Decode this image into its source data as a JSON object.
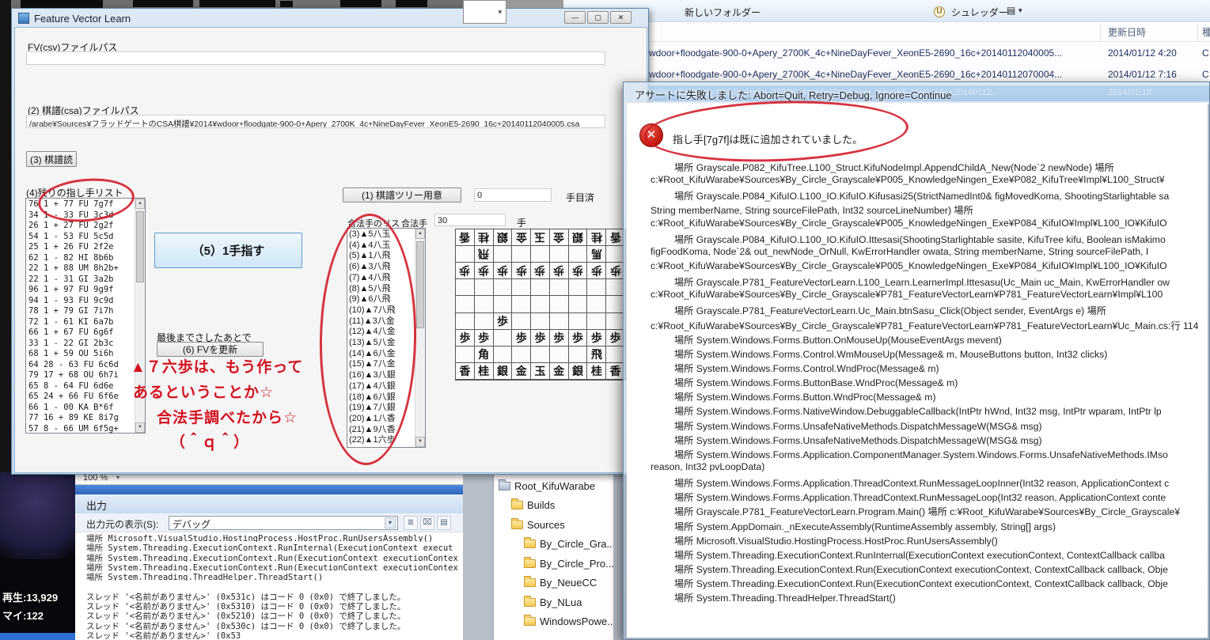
{
  "icons": {
    "minimize": "—",
    "maximize": "▢",
    "close": "✕",
    "caret_down": "▾",
    "arrow_up": "▲",
    "arrow_down": "▼",
    "error_cross": "✕",
    "circled_u": "U",
    "list_view": "▤",
    "large_view": "▦",
    "clear": "⌧",
    "wrap": "≣"
  },
  "fv_window": {
    "title": "Feature Vector Learn",
    "fv_path_label": "FV(csv)ファイルパス",
    "fv_path_value": "",
    "csa_path_label": "(2) 棋譜(csa)ファイルパス",
    "csa_path_value": "/arabe¥Sources¥フラッドゲートのCSA棋譜¥2014¥wdoor+floodgate-900-0+Apery_2700K_4c+NineDayFever_XeonE5-2690_16c+20140112040005.csa",
    "read_button": "(3) 棋譜読",
    "remaining_label": "(4)残りの指し手リスト",
    "moves": [
      "76 1 + 77 FU 7g7f",
      "34 1 - 33 FU 3c3d",
      "26 1 + 27 FU 2g2f",
      "54 1 - 53 FU 5c5d",
      "25 1 + 26 FU 2f2e",
      "62 1 - 82 HI 8b6b",
      "22 1 + 88 UM 8h2b+",
      "22 1 - 31 GI 3a2b",
      "96 1 + 97 FU 9g9f",
      "94 1 - 93 FU 9c9d",
      "78 1 + 79 GI 7i7h",
      "72 1 - 61 KI 6a7b",
      "66 1 + 67 FU 6g6f",
      "33 1 - 22 GI 2b3c",
      "68 1 + 59 OU 5i6h",
      "64 28 - 63 FU 6c6d",
      "79 17 + 68 OU 6h7i",
      "65 8 - 64 FU 6d6e",
      "65 24 + 66 FU 6f6e",
      "66 1 - 00 KA B*6f",
      "77 16 + 89 KE 8i7g",
      "57 8 - 66 UM 6f5g+"
    ],
    "play_button": "（5）1手指す",
    "after_label": "最後までさしたあとで",
    "fv_update_button": "(6) FVを更新",
    "tree_button": "(1) 棋譜ツリー用意",
    "steps_done_value": "0",
    "steps_done_label": "手目済",
    "legal_list_label": "合法手のリス",
    "legal_label": "合法手",
    "legal_count": "30",
    "legal_unit": "手",
    "legal_moves": [
      "(3)▲5八玉",
      "(4)▲4八玉",
      "(5)▲1八飛",
      "(6)▲3八飛",
      "(7)▲4八飛",
      "(8)▲5八飛",
      "(9)▲6八飛",
      "(10)▲7八飛",
      "(11)▲3八金",
      "(12)▲4八金",
      "(13)▲5八金",
      "(14)▲6八金",
      "(15)▲7八金",
      "(16)▲3八銀",
      "(17)▲4八銀",
      "(18)▲6八銀",
      "(19)▲7八銀",
      "(20)▲1八香",
      "(21)▲9八香",
      "(22)▲1六歩"
    ],
    "annotations": [
      "▲７六歩は、もう作って",
      "あるということか☆",
      "合法手調べたから☆",
      "（＾ｑ＾）"
    ],
    "board": [
      [
        "v香",
        "v桂",
        "v銀",
        "v金",
        "v玉",
        "v金",
        "v銀",
        "v桂",
        "v香"
      ],
      [
        "",
        "v飛",
        "",
        "",
        "",
        "",
        "",
        "v馬",
        ""
      ],
      [
        "v歩",
        "v歩",
        "v歩",
        "v歩",
        "v歩",
        "v歩",
        "v歩",
        "v歩",
        "v歩"
      ],
      [
        "",
        "",
        "",
        "",
        "",
        "",
        "",
        "",
        ""
      ],
      [
        "",
        "",
        "",
        "",
        "",
        "",
        "",
        "",
        ""
      ],
      [
        "",
        "",
        "歩",
        "",
        "",
        "",
        "",
        "",
        ""
      ],
      [
        "歩",
        "歩",
        "",
        "歩",
        "歩",
        "歩",
        "歩",
        "歩",
        "歩"
      ],
      [
        "",
        "角",
        "",
        "",
        "",
        "",
        "",
        "飛",
        ""
      ],
      [
        "香",
        "桂",
        "銀",
        "金",
        "玉",
        "金",
        "銀",
        "桂",
        "香"
      ]
    ]
  },
  "explorer": {
    "new_folder": "新しいフォルダー",
    "shredder": "シュレッダー",
    "col_date": "更新日時",
    "col_kind": "種",
    "files": [
      {
        "name": "wdoor+floodgate-900-0+Apery_2700K_4c+NineDayFever_XeonE5-2690_16c+20140112040005...",
        "date": "2014/01/12 4:20",
        "kind": "C",
        "selected": false
      },
      {
        "name": "wdoor+floodgate-900-0+Apery_2700K_4c+NineDayFever_XeonE5-2690_16c+20140112070004...",
        "date": "2014/01/12 7:16",
        "kind": "C",
        "selected": false
      },
      {
        "name": "wdoor+floodgate-900-0+Apery_2700K_4c+NineDayFever_XeonE5-2690_16c+20140112...",
        "date": "2014/01/12",
        "kind": "",
        "selected": true
      }
    ]
  },
  "assert_dialog": {
    "title": "アサートに失敗しました: Abort=Quit, Retry=Debug, Ignore=Continue",
    "message": "指し手[7g7f]は既に追加されていました。",
    "stack": [
      {
        "i": 1,
        "t": "場所 Grayscale.P082_KifuTree.L100_Struct.KifuNodeImpl.AppendChildA_New(Node`2 newNode) 場所"
      },
      {
        "i": 0,
        "t": "c:¥Root_KifuWarabe¥Sources¥By_Circle_Grayscale¥P005_KnowledgeNingen_Exe¥P082_KifuTree¥Impl¥L100_Struct¥"
      },
      {
        "i": 1,
        "t": "場所 Grayscale.P084_KifuIO.L100_IO.KifuIO.Kifusasi25(StrictNamedInt0& figMovedKoma, ShootingStarlightable sa"
      },
      {
        "i": 0,
        "t": "String memberName, String sourceFilePath, Int32 sourceLineNumber) 場所"
      },
      {
        "i": 0,
        "t": "c:¥Root_KifuWarabe¥Sources¥By_Circle_Grayscale¥P005_KnowledgeNingen_Exe¥P084_KifuIO¥Impl¥L100_IO¥KifuIO"
      },
      {
        "i": 1,
        "t": "場所 Grayscale.P084_KifuIO.L100_IO.KifuIO.Ittesasi(ShootingStarlightable sasite, KifuTree kifu, Boolean isMakimo"
      },
      {
        "i": 0,
        "t": "figFoodKoma, Node`2& out_newNode_OrNull, KwErrorHandler owata, String memberName, String sourceFilePath, I"
      },
      {
        "i": 0,
        "t": "c:¥Root_KifuWarabe¥Sources¥By_Circle_Grayscale¥P005_KnowledgeNingen_Exe¥P084_KifuIO¥Impl¥L100_IO¥KifuIO"
      },
      {
        "i": 1,
        "t": "場所 Grayscale.P781_FeatureVectorLearn.L100_Learn.LearnerImpl.Ittesasu(Uc_Main uc_Main, KwErrorHandler ow"
      },
      {
        "i": 0,
        "t": "c:¥Root_KifuWarabe¥Sources¥By_Circle_Grayscale¥P781_FeatureVectorLearn¥P781_FeatureVectorLearn¥Impl¥L100"
      },
      {
        "i": 1,
        "t": "場所 Grayscale.P781_FeatureVectorLearn.Uc_Main.btnSasu_Click(Object sender, EventArgs e) 場所"
      },
      {
        "i": 0,
        "t": "c:¥Root_KifuWarabe¥Sources¥By_Circle_Grayscale¥P781_FeatureVectorLearn¥P781_FeatureVectorLearn¥Uc_Main.cs:行 114"
      },
      {
        "i": 1,
        "t": "場所 System.Windows.Forms.Button.OnMouseUp(MouseEventArgs mevent)"
      },
      {
        "i": 1,
        "t": "場所 System.Windows.Forms.Control.WmMouseUp(Message& m, MouseButtons button, Int32 clicks)"
      },
      {
        "i": 1,
        "t": "場所 System.Windows.Forms.Control.WndProc(Message& m)"
      },
      {
        "i": 1,
        "t": "場所 System.Windows.Forms.ButtonBase.WndProc(Message& m)"
      },
      {
        "i": 1,
        "t": "場所 System.Windows.Forms.Button.WndProc(Message& m)"
      },
      {
        "i": 1,
        "t": "場所 System.Windows.Forms.NativeWindow.DebuggableCallback(IntPtr hWnd, Int32 msg, IntPtr wparam, IntPtr lp"
      },
      {
        "i": 1,
        "t": "場所 System.Windows.Forms.UnsafeNativeMethods.DispatchMessageW(MSG& msg)"
      },
      {
        "i": 1,
        "t": "場所 System.Windows.Forms.UnsafeNativeMethods.DispatchMessageW(MSG& msg)"
      },
      {
        "i": 1,
        "t": "場所 System.Windows.Forms.Application.ComponentManager.System.Windows.Forms.UnsafeNativeMethods.IMso"
      },
      {
        "i": 0,
        "t": "reason, Int32 pvLoopData)"
      },
      {
        "i": 1,
        "t": "場所 System.Windows.Forms.Application.ThreadContext.RunMessageLoopInner(Int32 reason, ApplicationContext c"
      },
      {
        "i": 1,
        "t": "場所 System.Windows.Forms.Application.ThreadContext.RunMessageLoop(Int32 reason, ApplicationContext conte"
      },
      {
        "i": 1,
        "t": "場所 Grayscale.P781_FeatureVectorLearn.Program.Main() 場所 c:¥Root_KifuWarabe¥Sources¥By_Circle_Grayscale¥"
      },
      {
        "i": 1,
        "t": "場所 System.AppDomain._nExecuteAssembly(RuntimeAssembly assembly, String[] args)"
      },
      {
        "i": 1,
        "t": "場所 Microsoft.VisualStudio.HostingProcess.HostProc.RunUsersAssembly()"
      },
      {
        "i": 1,
        "t": "場所 System.Threading.ExecutionContext.RunInternal(ExecutionContext executionContext, ContextCallback callba"
      },
      {
        "i": 1,
        "t": "場所 System.Threading.ExecutionContext.Run(ExecutionContext executionContext, ContextCallback callback, Obje"
      },
      {
        "i": 1,
        "t": "場所 System.Threading.ExecutionContext.Run(ExecutionContext executionContext, ContextCallback callback, Obje"
      },
      {
        "i": 1,
        "t": "場所 System.Threading.ThreadHelper.ThreadStart()"
      }
    ]
  },
  "vs_output": {
    "zoom": "100 %",
    "pane_title": "出力",
    "source_label": "出力元の表示(S):",
    "source_value": "デバッグ",
    "lines": [
      "場所 Microsoft.VisualStudio.HostingProcess.HostProc.RunUsersAssembly()",
      "場所 System.Threading.ExecutionContext.RunInternal(ExecutionContext execut",
      "場所 System.Threading.ExecutionContext.Run(ExecutionContext executionContex",
      "場所 System.Threading.ExecutionContext.Run(ExecutionContext executionContex",
      "場所 System.Threading.ThreadHelper.ThreadStart()",
      "",
      "スレッド '<名前がありません>' (0x531c) はコード 0 (0x0) で終了しました。",
      "スレッド '<名前がありません>' (0x5310) はコード 0 (0x0) で終了しました。",
      "スレッド '<名前がありません>' (0x5210) はコード 0 (0x0) で終了しました。",
      "スレッド '<名前がありません>' (0x530c) はコード 0 (0x0) で終了しました。",
      "スレッド '<名前がありません>' (0x53"
    ]
  },
  "folder_tree": {
    "items": [
      {
        "label": "Root_KifuWarabe",
        "level": 0,
        "kind": "root"
      },
      {
        "label": "Builds",
        "level": 1,
        "kind": "folder"
      },
      {
        "label": "Sources",
        "level": 1,
        "kind": "folder"
      },
      {
        "label": "By_Circle_Gra...",
        "level": 2,
        "kind": "folder"
      },
      {
        "label": "By_Circle_Pro...",
        "level": 2,
        "kind": "folder"
      },
      {
        "label": "By_NeueCC",
        "level": 2,
        "kind": "folder"
      },
      {
        "label": "By_NLua",
        "level": 2,
        "kind": "folder"
      },
      {
        "label": "WindowsPowe...",
        "level": 2,
        "kind": "folder"
      }
    ]
  },
  "desktop": {
    "play_count": "再生:13,929",
    "my_count": "マイ:122"
  },
  "colors": {
    "annotation_red": "#d40f1e",
    "selection_blue": "#3a7fd0",
    "vs_blue": "#3f7fd6"
  }
}
